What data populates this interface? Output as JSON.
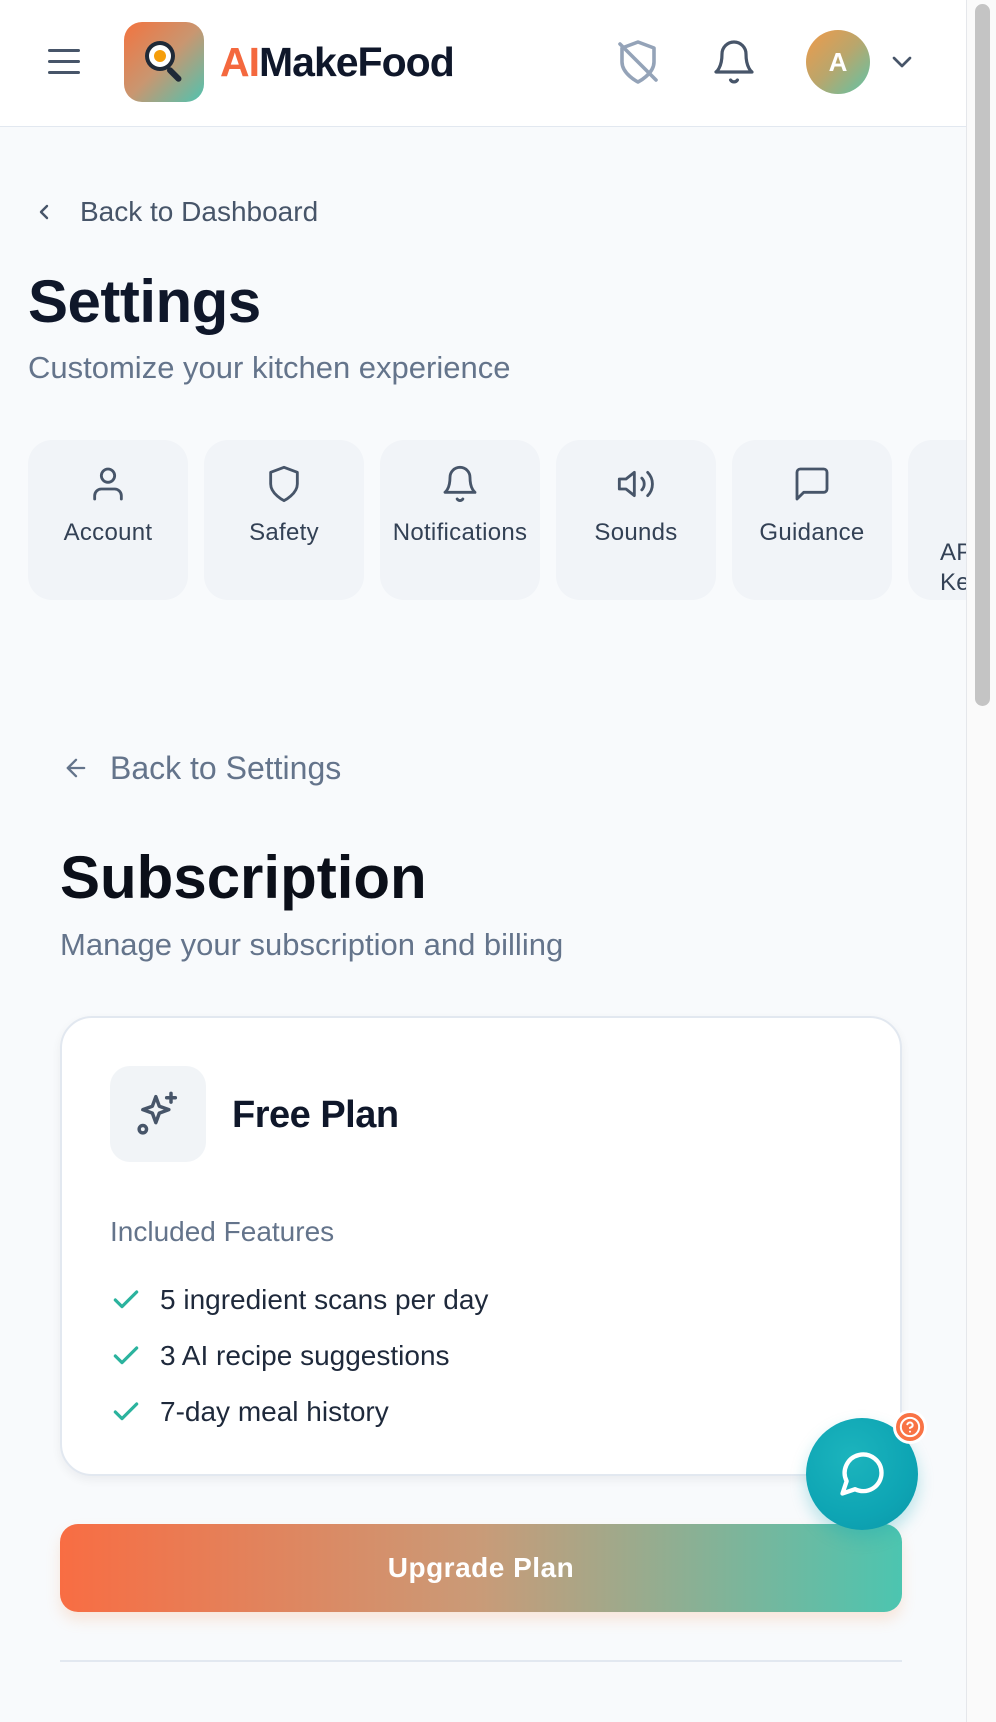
{
  "header": {
    "brand_prefix": "AI",
    "brand_suffix": "MakeFood",
    "avatar_initial": "A",
    "icons": [
      "menu-icon",
      "logo-icon",
      "shield-off-icon",
      "bell-icon",
      "chevron-down-icon"
    ],
    "colors": {
      "brand_accent": "#f4683e",
      "brand_text": "#0f172a"
    }
  },
  "nav": {
    "back_label": "Back to Dashboard"
  },
  "page": {
    "title": "Settings",
    "subtitle": "Customize your kitchen experience"
  },
  "tabs": [
    {
      "label": "Account",
      "icon": "user-icon"
    },
    {
      "label": "Safety",
      "icon": "shield-icon"
    },
    {
      "label": "Notifications",
      "icon": "bell-icon"
    },
    {
      "label": "Sounds",
      "icon": "speaker-icon"
    },
    {
      "label": "Guidance",
      "icon": "message-square-icon"
    },
    {
      "label": "API Ke",
      "icon": "key-icon"
    }
  ],
  "subscription": {
    "back_label": "Back to Settings",
    "title": "Subscription",
    "subtitle": "Manage your subscription and billing",
    "plan": {
      "name": "Free Plan",
      "icon": "sparkles-icon",
      "features_heading": "Included Features",
      "features": [
        "5 ingredient scans per day",
        "3 AI recipe suggestions",
        "7-day meal history"
      ]
    },
    "upgrade_label": "Upgrade Plan"
  },
  "fab": {
    "icon": "chat-bubble-icon",
    "badge_icon": "help-circle-icon"
  },
  "theme": {
    "primary_gradient": [
      "#f86d43",
      "#c99b78",
      "#4cc5b0"
    ],
    "teal": "#0ea5b4",
    "check": "#2bb39e"
  }
}
